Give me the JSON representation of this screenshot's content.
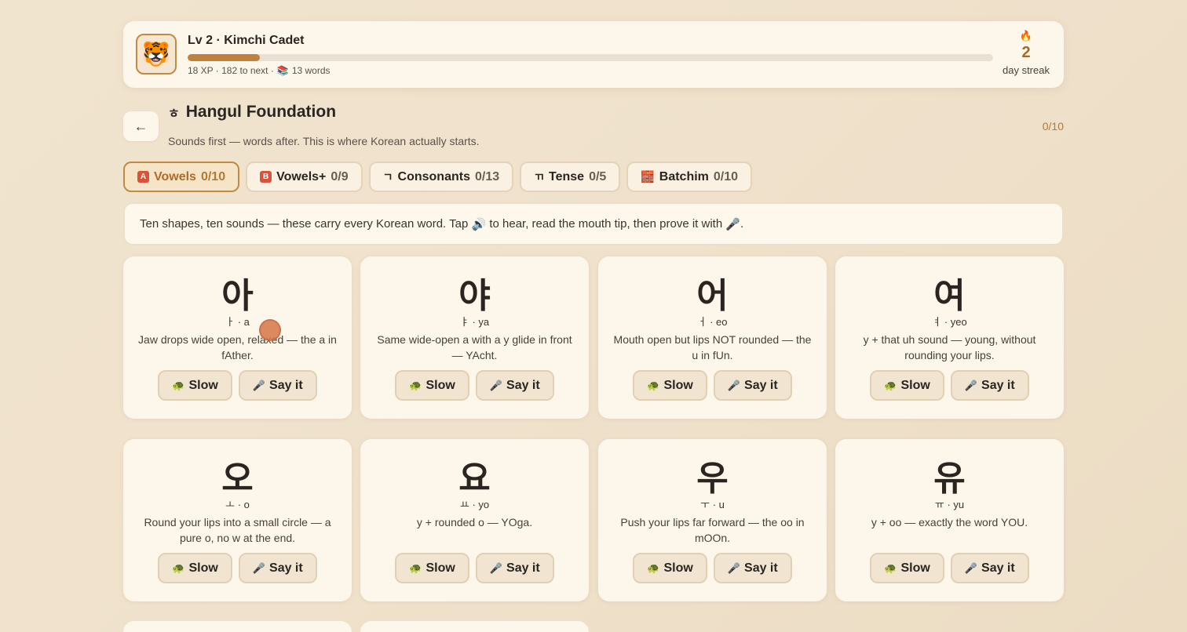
{
  "header": {
    "avatar_icon": "🐯",
    "level_title": "Lv 2 · Kimchi Cadet",
    "xp_progress": 0.09,
    "xp_text": "18 XP · 182 to next ·",
    "words_icon": "📚",
    "words_text": "13 words",
    "streak_icon": "🔥",
    "streak_count": "2",
    "streak_label": "day streak"
  },
  "section": {
    "back_label": "←",
    "glyph": "ㅎ",
    "title": "Hangul Foundation",
    "subtitle": "Sounds first — words after. This is where Korean actually starts.",
    "progress": "0/10"
  },
  "tabs": [
    {
      "icon": "A",
      "icon_type": "badge",
      "label": "Vowels",
      "count": "0/10",
      "active": true
    },
    {
      "icon": "B",
      "icon_type": "badge",
      "label": "Vowels+",
      "count": "0/9",
      "active": false
    },
    {
      "icon": "ㄱ",
      "icon_type": "plain",
      "label": "Consonants",
      "count": "0/13",
      "active": false
    },
    {
      "icon": "ㄲ",
      "icon_type": "plain",
      "label": "Tense",
      "count": "0/5",
      "active": false
    },
    {
      "icon": "🧱",
      "icon_type": "plain",
      "label": "Batchim",
      "count": "0/10",
      "active": false
    }
  ],
  "intro": {
    "text_before": "Ten shapes, ten sounds — these carry every Korean word. Tap",
    "speaker_icon": "🔊",
    "text_middle": "to hear, read the mouth tip, then prove it with",
    "mic_icon": "🎤",
    "text_after": "."
  },
  "buttons": {
    "slow_icon": "🐢",
    "slow_label": "Slow",
    "say_icon": "🎤",
    "say_label": "Say it"
  },
  "cards": [
    {
      "char": "아",
      "roman": "ㅏ · a",
      "tip": "Jaw drops wide open, relaxed — the a in fAther."
    },
    {
      "char": "야",
      "roman": "ㅑ · ya",
      "tip": "Same wide-open a with a y glide in front — YAcht."
    },
    {
      "char": "어",
      "roman": "ㅓ · eo",
      "tip": "Mouth open but lips NOT rounded — the u in fUn."
    },
    {
      "char": "여",
      "roman": "ㅕ · yeo",
      "tip": "y + that uh sound — young, without rounding your lips."
    },
    {
      "char": "오",
      "roman": "ㅗ · o",
      "tip": "Round your lips into a small circle — a pure o, no w at the end."
    },
    {
      "char": "요",
      "roman": "ㅛ · yo",
      "tip": "y + rounded o — YOga."
    },
    {
      "char": "우",
      "roman": "ㅜ · u",
      "tip": "Push your lips far forward — the oo in mOOn."
    },
    {
      "char": "유",
      "roman": "ㅠ · yu",
      "tip": "y + oo — exactly the word YOU."
    }
  ]
}
